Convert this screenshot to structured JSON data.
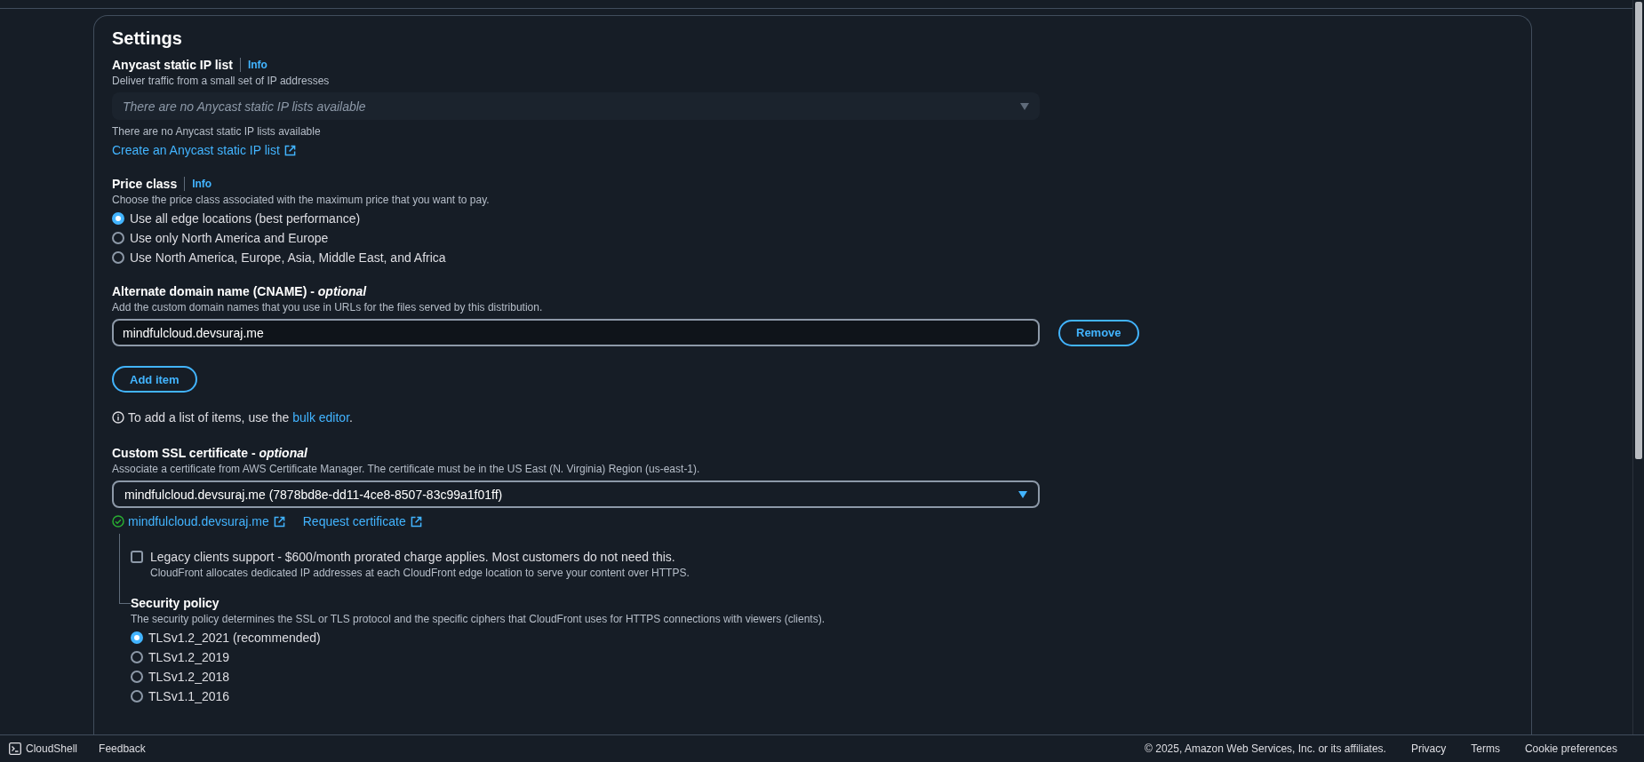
{
  "settings": {
    "title": "Settings",
    "anycast": {
      "label": "Anycast static IP list",
      "info": "Info",
      "description": "Deliver traffic from a small set of IP addresses",
      "placeholder": "There are no Anycast static IP lists available",
      "note": "There are no Anycast static IP lists available",
      "link": "Create an Anycast static IP list"
    },
    "price_class": {
      "label": "Price class",
      "info": "Info",
      "description": "Choose the price class associated with the maximum price that you want to pay.",
      "options": [
        {
          "label": "Use all edge locations (best performance)",
          "selected": true
        },
        {
          "label": "Use only North America and Europe",
          "selected": false
        },
        {
          "label": "Use North America, Europe, Asia, Middle East, and Africa",
          "selected": false
        }
      ]
    },
    "cname": {
      "label": "Alternate domain name (CNAME) - *optional*",
      "description": "Add the custom domain names that you use in URLs for the files served by this distribution.",
      "items": [
        {
          "value": "mindfulcloud.devsuraj.me",
          "remove": "Remove"
        }
      ],
      "add_button": "Add item",
      "hint": "To add a list of items, use the",
      "hint_link": "bulk editor",
      "hint_end": "."
    },
    "ssl": {
      "label": "Custom SSL certificate - *optional*",
      "description": "Associate a certificate from AWS Certificate Manager. The certificate must be in the US East (N. Virginia) Region (us-east-1).",
      "value": "mindfulcloud.devsuraj.me (7878bd8e-dd11-4ce8-8507-83c99a1f01ff)",
      "status_link": "mindfulcloud.devsuraj.me",
      "request_link": "Request certificate"
    },
    "legacy": {
      "label": "Legacy clients support - $600/month prorated charge applies. Most customers do not need this.",
      "description": "CloudFront allocates dedicated IP addresses at each CloudFront edge location to serve your content over HTTPS.",
      "checked": false
    },
    "security_policy": {
      "label": "Security policy",
      "description": "The security policy determines the SSL or TLS protocol and the specific ciphers that CloudFront uses for HTTPS connections with viewers (clients).",
      "options": [
        {
          "label": "TLSv1.2_2021 (recommended)",
          "selected": true
        },
        {
          "label": "TLSv1.2_2019",
          "selected": false
        },
        {
          "label": "TLSv1.2_2018",
          "selected": false
        },
        {
          "label": "TLSv1.1_2016",
          "selected": false
        }
      ]
    }
  },
  "footer": {
    "cloudshell": "CloudShell",
    "feedback": "Feedback",
    "copyright": "© 2025, Amazon Web Services, Inc. or its affiliates.",
    "links": [
      "Privacy",
      "Terms",
      "Cookie preferences"
    ]
  }
}
